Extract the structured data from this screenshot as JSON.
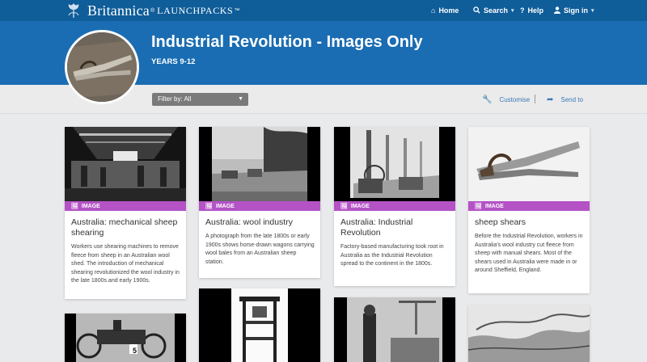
{
  "brand": {
    "name": "Britannica",
    "reg": "®",
    "product": "LAUNCHPACKS",
    "tm": "™"
  },
  "nav": {
    "home": "Home",
    "search": "Search",
    "help": "Help",
    "signin": "Sign in"
  },
  "hero": {
    "title": "Industrial Revolution - Images Only",
    "subtitle": "YEARS 9-12"
  },
  "toolbar": {
    "filter_label": "Filter by: All",
    "customise": "Customise",
    "send_to": "Send to"
  },
  "cards": [
    {
      "badge": "IMAGE",
      "title": "Australia: mechanical sheep shearing",
      "desc": "Workers use shearing machines to remove fleece from sheep in an Australian wool shed. The introduction of mechanical shearing revolutionized the wool industry in the late 1800s and early 1900s."
    },
    {
      "badge": "IMAGE",
      "title": "Australia: wool industry",
      "desc": "A photograph from the late 1800s or early 1900s shows horse-drawn wagons carrying wool bales from an Australian sheep station."
    },
    {
      "badge": "IMAGE",
      "title": "Australia: Industrial Revolution",
      "desc": "Factory-based manufacturing took root in Australia as the Industrial Revolution spread to the continent in the 1800s."
    },
    {
      "badge": "IMAGE",
      "title": "sheep shears",
      "desc": "Before the Industrial Revolution, workers in Australia's wool industry cut fleece from sheep with manual shears. Most of the shears used in Australia were made in or around Sheffield, England."
    }
  ],
  "card_number_plate": "5"
}
